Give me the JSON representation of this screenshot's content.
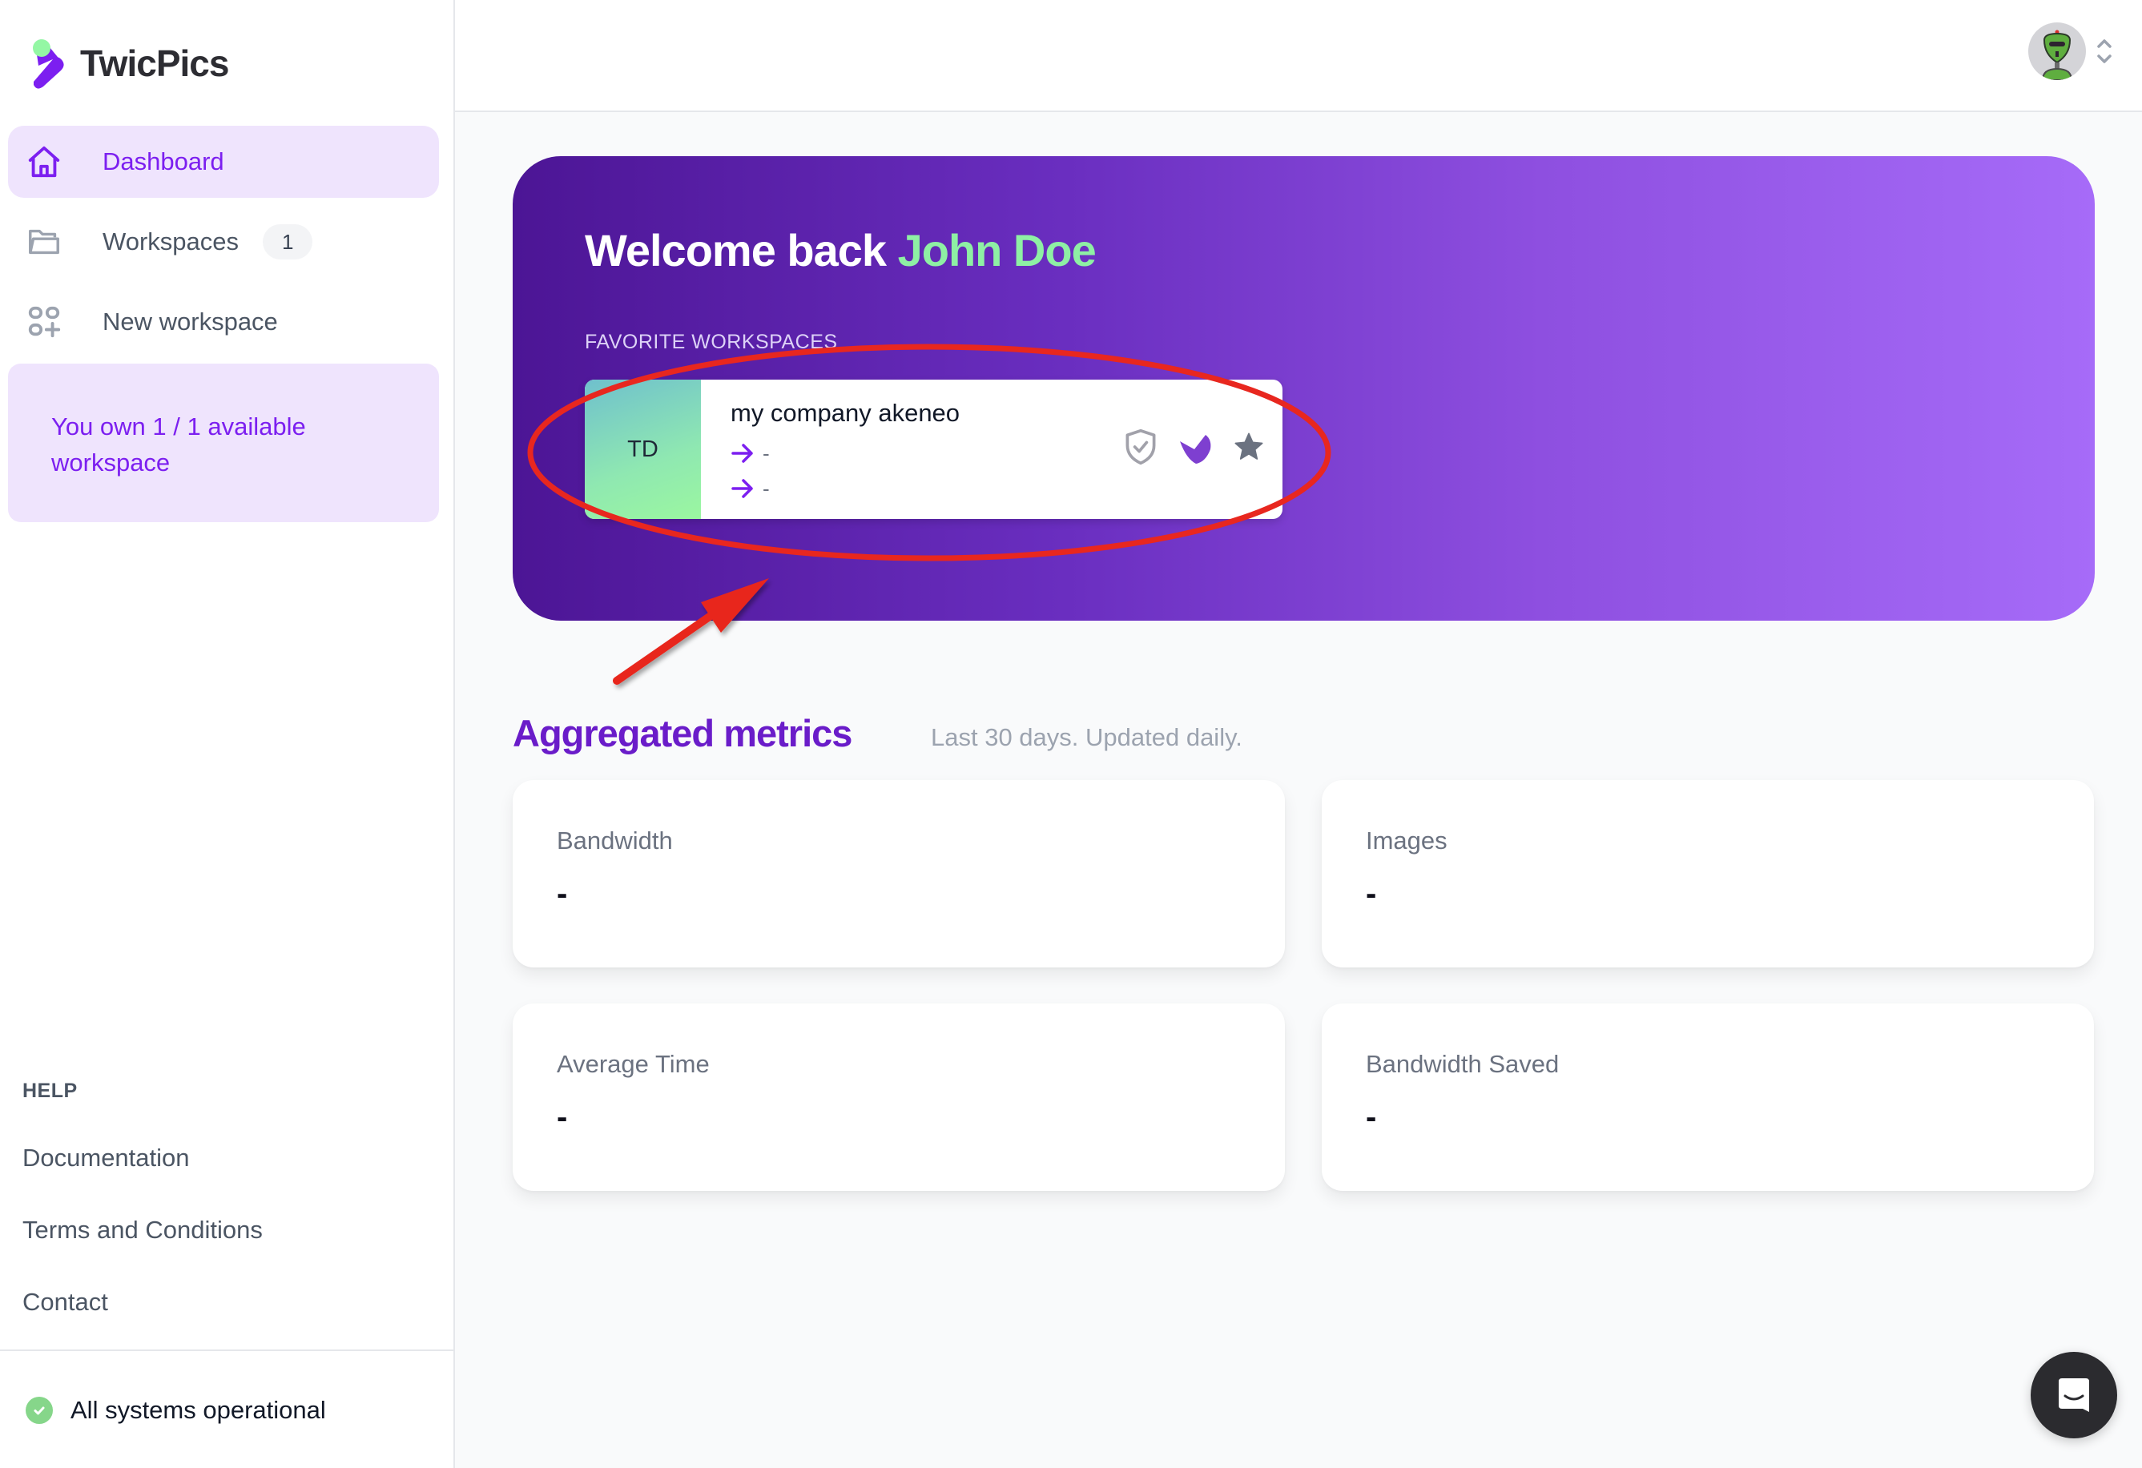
{
  "app": {
    "name": "TwicPics",
    "colors": {
      "brand_purple": "#7c1ff0",
      "brand_green": "#8ef0a4",
      "sidebar_active_bg": "#efe4fd",
      "status_green": "#86d68a",
      "annotation_red": "#e8271f"
    }
  },
  "sidebar": {
    "nav": [
      {
        "label": "Dashboard",
        "icon": "home-icon",
        "active": true
      },
      {
        "label": "Workspaces",
        "icon": "folder-icon",
        "badge": "1"
      },
      {
        "label": "New workspace",
        "icon": "add-grid-icon"
      }
    ],
    "quota_text": "You own 1 / 1 available workspace",
    "help": {
      "title": "HELP",
      "links": [
        "Documentation",
        "Terms and Conditions",
        "Contact"
      ]
    },
    "status_text": "All systems operational"
  },
  "header": {
    "avatar_icon": "robot-avatar",
    "menu_icon": "chevron-up-down-icon"
  },
  "banner": {
    "welcome_prefix": "Welcome back",
    "user_name": "John Doe",
    "favorites_label": "FAVORITE WORKSPACES",
    "favorite_workspaces": [
      {
        "initials": "TD",
        "name": "my company akeneo",
        "line1": "-",
        "line2": "-",
        "icons": [
          "shield-check-icon",
          "akeneo-logo-icon",
          "star-icon"
        ]
      }
    ]
  },
  "metrics": {
    "title": "Aggregated metrics",
    "subtitle": "Last 30 days. Updated daily.",
    "cards": [
      {
        "label": "Bandwidth",
        "value": "-"
      },
      {
        "label": "Images",
        "value": "-"
      },
      {
        "label": "Average Time",
        "value": "-"
      },
      {
        "label": "Bandwidth Saved",
        "value": "-"
      }
    ]
  },
  "chat": {
    "icon": "chat-bubble-icon"
  }
}
